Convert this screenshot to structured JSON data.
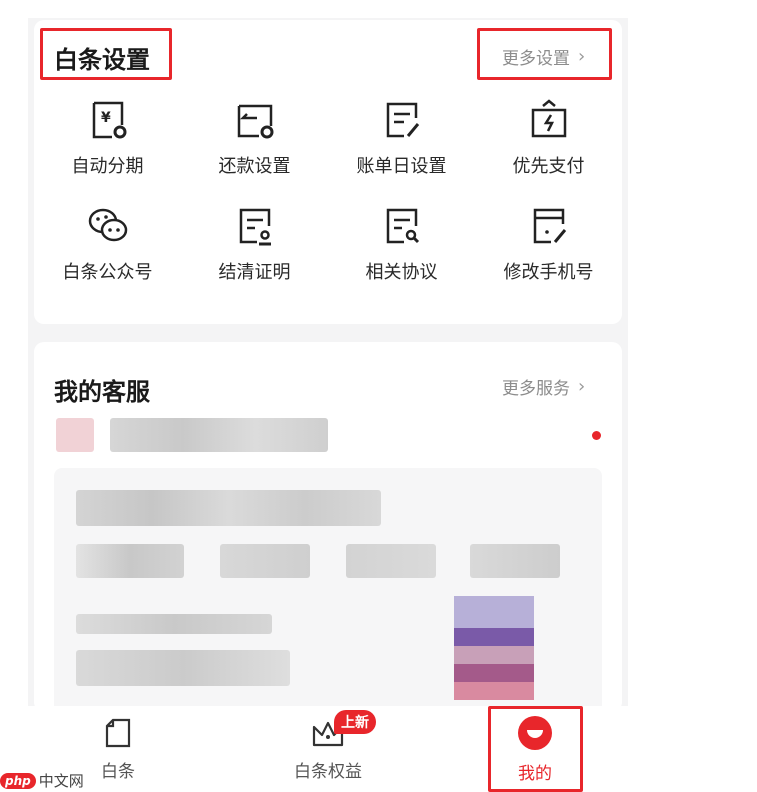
{
  "settings": {
    "title": "白条设置",
    "more_label": "更多设置",
    "items": [
      {
        "label": "自动分期",
        "icon": "auto-installment-icon"
      },
      {
        "label": "还款设置",
        "icon": "repayment-settings-icon"
      },
      {
        "label": "账单日设置",
        "icon": "bill-date-icon"
      },
      {
        "label": "优先支付",
        "icon": "priority-pay-icon"
      },
      {
        "label": "白条公众号",
        "icon": "wechat-account-icon"
      },
      {
        "label": "结清证明",
        "icon": "settlement-proof-icon"
      },
      {
        "label": "相关协议",
        "icon": "agreement-icon"
      },
      {
        "label": "修改手机号",
        "icon": "edit-phone-icon"
      }
    ]
  },
  "service": {
    "title": "我的客服",
    "more_label": "更多服务"
  },
  "tabbar": {
    "tabs": [
      {
        "label": "白条",
        "icon": "baitiao-tab-icon"
      },
      {
        "label": "白条权益",
        "icon": "crown-icon",
        "badge": "上新"
      },
      {
        "label": "我的",
        "icon": "profile-tab-icon",
        "active": true
      }
    ]
  },
  "watermark": {
    "logo": "php",
    "text": "中文网"
  },
  "colors": {
    "accent": "#e8262b",
    "muted": "#8c8c8c",
    "background": "#f4f4f5"
  }
}
